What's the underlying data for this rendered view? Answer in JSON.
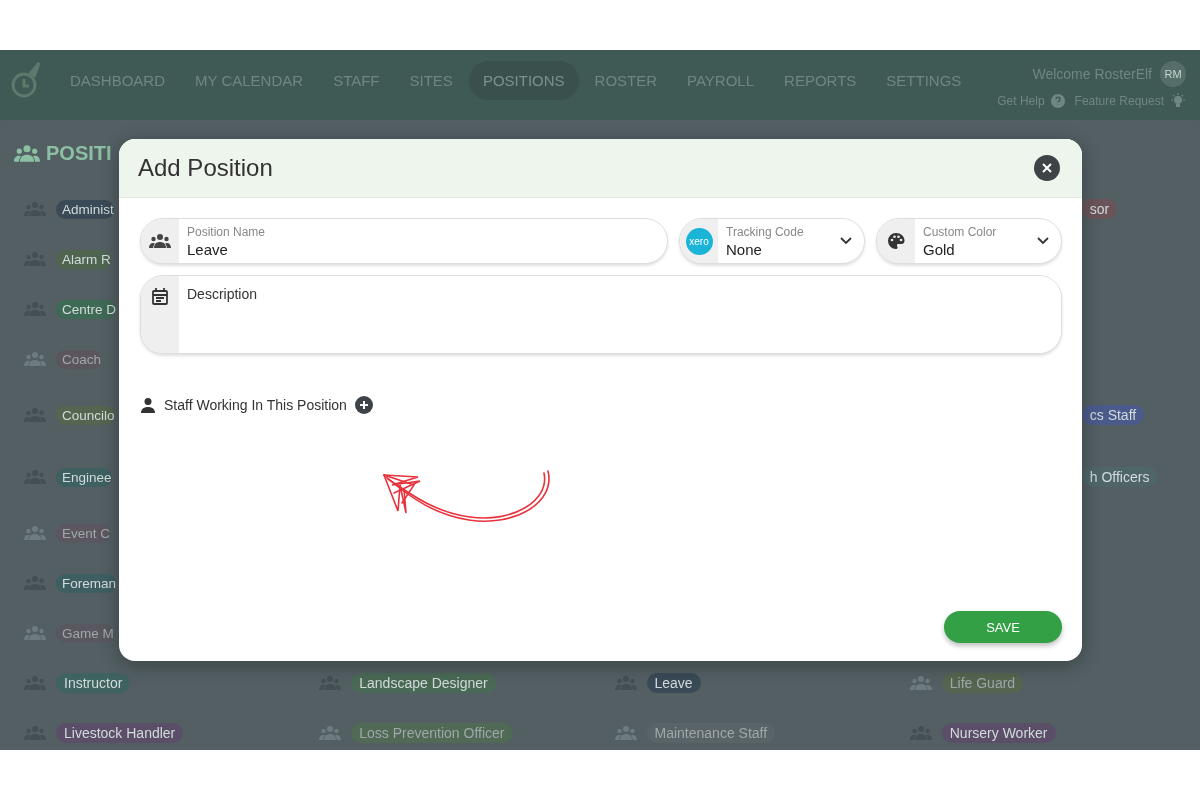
{
  "nav": {
    "items": [
      {
        "label": "DASHBOARD",
        "selected": false
      },
      {
        "label": "MY CALENDAR",
        "selected": false
      },
      {
        "label": "STAFF",
        "selected": false
      },
      {
        "label": "SITES",
        "selected": false
      },
      {
        "label": "POSITIONS",
        "selected": true
      },
      {
        "label": "ROSTER",
        "selected": false
      },
      {
        "label": "PAYROLL",
        "selected": false
      },
      {
        "label": "REPORTS",
        "selected": false
      },
      {
        "label": "SETTINGS",
        "selected": false
      }
    ],
    "welcome": "Welcome RosterElf",
    "avatar": "RM",
    "help": "Get Help",
    "feature_request": "Feature Request"
  },
  "page": {
    "heading": "POSITI",
    "rows": [
      {
        "left": {
          "label": "Administ",
          "color": "#3a4a56",
          "inactive": false
        },
        "right": {
          "label": "sor",
          "color": "#6a5459",
          "inactive": false
        }
      },
      {
        "left": {
          "label": "Alarm R",
          "color": "#4f6550",
          "inactive": false
        }
      },
      {
        "left": {
          "label": "Centre D",
          "color": "#3f6a55",
          "inactive": false
        }
      },
      {
        "left": {
          "label": "Coach",
          "color": "#5b565e",
          "inactive": true
        }
      },
      {
        "left": {
          "label": "Councilo",
          "color": "#56654f",
          "inactive": false
        },
        "right": {
          "label": "cs Staff",
          "color": "#4a5a8a",
          "inactive": false
        }
      },
      {
        "left": {
          "label": "Enginee",
          "color": "#3e6060",
          "inactive": false
        },
        "right": {
          "label": "h Officers",
          "color": "#4f6668",
          "inactive": false
        }
      },
      {
        "left": {
          "label": "Event C",
          "color": "#5b5660",
          "inactive": true
        }
      },
      {
        "left": {
          "label": "Foreman",
          "color": "#3e5f62",
          "inactive": false
        }
      },
      {
        "left": {
          "label": "Game M",
          "color": "#595760",
          "inactive": true
        }
      }
    ],
    "bottom_rows": [
      {
        "cells": [
          {
            "label": "Instructor",
            "color": "#3f6360",
            "inactive": false
          },
          {
            "label": "Landscape Designer",
            "color": "#4a6a55",
            "inactive": false
          },
          {
            "label": "Leave",
            "color": "#3a4a56",
            "inactive": false
          },
          {
            "label": "Life Guard",
            "color": "#56654f",
            "inactive": true
          }
        ]
      },
      {
        "cells": [
          {
            "label": "Livestock Handler",
            "color": "#5a4e68",
            "inactive": false
          },
          {
            "label": "Loss Prevention Officer",
            "color": "#506a55",
            "inactive": true
          },
          {
            "label": "Maintenance Staff",
            "color": "#5a6468",
            "inactive": true
          },
          {
            "label": "Nursery Worker",
            "color": "#5a4e68",
            "inactive": false
          }
        ]
      }
    ]
  },
  "dialog": {
    "title": "Add Position",
    "position_name": {
      "label": "Position Name",
      "value": "Leave"
    },
    "tracking_code": {
      "logo": "xero",
      "label": "Tracking Code",
      "value": "None"
    },
    "custom_color": {
      "label": "Custom Color",
      "value": "Gold"
    },
    "description": {
      "placeholder": "Description"
    },
    "staff_heading": "Staff Working In This Position",
    "save": "SAVE"
  }
}
